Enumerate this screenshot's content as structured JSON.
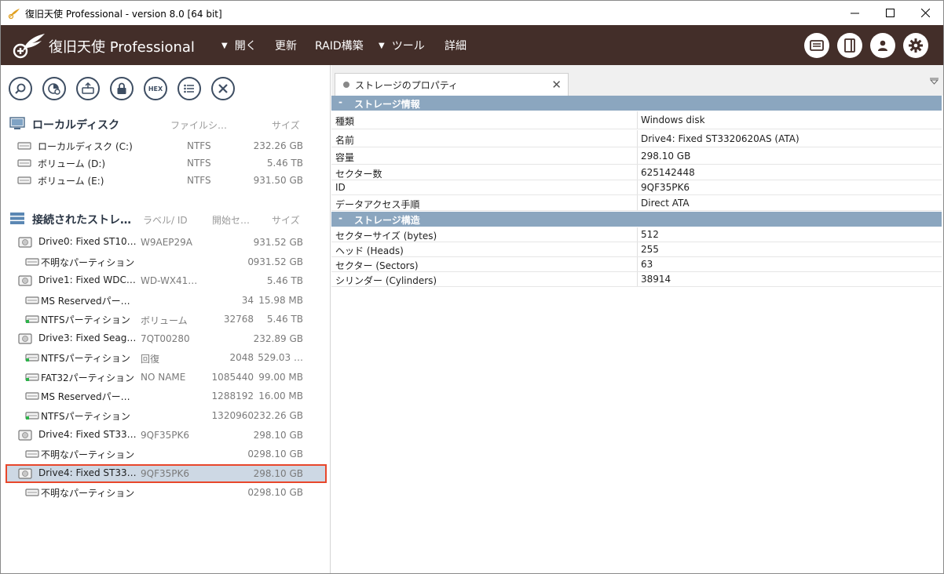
{
  "window": {
    "title": "復旧天使 Professional - version 8.0 [64 bit]"
  },
  "toolbar": {
    "brand": "復旧天使 Professional",
    "menus": [
      {
        "label": "開く",
        "has_arrow": true
      },
      {
        "label": "更新",
        "has_arrow": false
      },
      {
        "label": "RAID構築",
        "has_arrow": false
      },
      {
        "label": "ツール",
        "has_arrow": true
      },
      {
        "label": "詳細",
        "has_arrow": false
      }
    ],
    "right_icons": [
      "log-icon",
      "panel-icon",
      "user-icon",
      "gear-icon"
    ]
  },
  "left_toolbar": {
    "buttons": [
      "search-icon",
      "scan-icon",
      "recover-icon",
      "lock-icon",
      "hex-icon",
      "list-icon",
      "close-icon"
    ],
    "hex_label": "HEX"
  },
  "local_disks": {
    "title": "ローカルディスク",
    "col_fs": "ファイルシ…",
    "col_size": "サイズ",
    "items": [
      {
        "name": "ローカルディスク (C:)",
        "fs": "NTFS",
        "size": "232.26 GB"
      },
      {
        "name": "ボリューム (D:)",
        "fs": "NTFS",
        "size": "5.46 TB"
      },
      {
        "name": "ボリューム (E:)",
        "fs": "NTFS",
        "size": "931.50 GB"
      }
    ]
  },
  "connected": {
    "title": "接続されたストレ…",
    "col_label": "ラベル/ ID",
    "col_start": "開始セ…",
    "col_size": "サイズ",
    "items": [
      {
        "name": "Drive0: Fixed ST10…",
        "label": "W9AEP29A",
        "start": "",
        "size": "931.52 GB",
        "type": "drive"
      },
      {
        "name": "不明なパーティション",
        "label": "",
        "start": "0",
        "size": "931.52 GB",
        "type": "part"
      },
      {
        "name": "Drive1: Fixed WDC…",
        "label": "WD-WX41…",
        "start": "",
        "size": "5.46 TB",
        "type": "drive"
      },
      {
        "name": "MS Reservedパー…",
        "label": "",
        "start": "34",
        "size": "15.98 MB",
        "type": "part"
      },
      {
        "name": "NTFSパーティション",
        "label": "ボリューム",
        "start": "32768",
        "size": "5.46 TB",
        "type": "part-green"
      },
      {
        "name": "Drive3: Fixed Seag…",
        "label": "7QT00280",
        "start": "",
        "size": "232.89 GB",
        "type": "drive"
      },
      {
        "name": "NTFSパーティション",
        "label": "回復",
        "start": "2048",
        "size": "529.03 …",
        "type": "part-green"
      },
      {
        "name": "FAT32パーティション",
        "label": "NO NAME",
        "start": "1085440",
        "size": "99.00 MB",
        "type": "part-green"
      },
      {
        "name": "MS Reservedパー…",
        "label": "",
        "start": "1288192",
        "size": "16.00 MB",
        "type": "part"
      },
      {
        "name": "NTFSパーティション",
        "label": "",
        "start": "1320960",
        "size": "232.26 GB",
        "type": "part-green"
      },
      {
        "name": "Drive4: Fixed ST33…",
        "label": "9QF35PK6",
        "start": "",
        "size": "298.10 GB",
        "type": "drive"
      },
      {
        "name": "不明なパーティション",
        "label": "",
        "start": "0",
        "size": "298.10 GB",
        "type": "part"
      },
      {
        "name": "Drive4: Fixed ST33…",
        "label": "9QF35PK6",
        "start": "",
        "size": "298.10 GB",
        "type": "drive",
        "selected": true
      },
      {
        "name": "不明なパーティション",
        "label": "",
        "start": "0",
        "size": "298.10 GB",
        "type": "part"
      }
    ]
  },
  "properties": {
    "tab_label": "ストレージのプロパティ",
    "group1": {
      "sign": "-",
      "title": "ストレージ情報",
      "rows": [
        {
          "key": "種類",
          "value": "Windows disk"
        },
        {
          "key": "名前",
          "value": "Drive4: Fixed ST3320620AS (ATA)"
        },
        {
          "key": "容量",
          "value": "298.10 GB"
        },
        {
          "key": "セクター数",
          "value": "625142448"
        },
        {
          "key": "ID",
          "value": "9QF35PK6"
        },
        {
          "key": "データアクセス手順",
          "value": "Direct ATA"
        }
      ]
    },
    "group2": {
      "sign": "-",
      "title": "ストレージ構造",
      "rows": [
        {
          "key": "セクターサイズ (bytes)",
          "value": "512"
        },
        {
          "key": "ヘッド (Heads)",
          "value": "255"
        },
        {
          "key": "セクター (Sectors)",
          "value": "63"
        },
        {
          "key": "シリンダー (Cylinders)",
          "value": "38914"
        }
      ]
    }
  }
}
